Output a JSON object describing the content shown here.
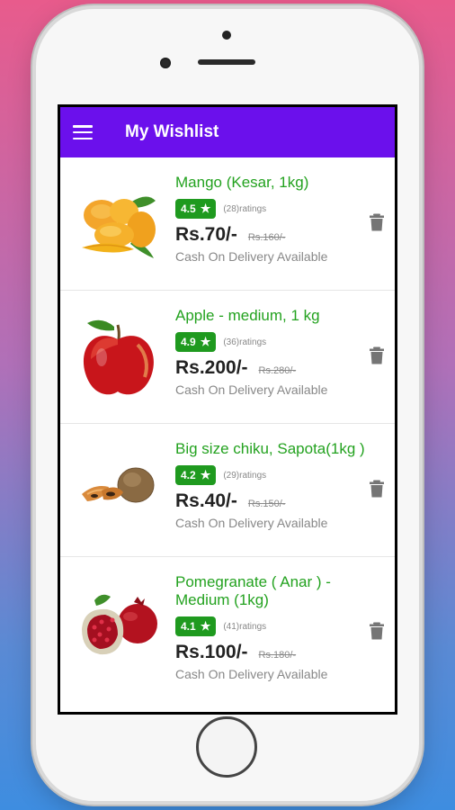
{
  "app_bar": {
    "title": "My Wishlist",
    "menu_icon": "hamburger-menu-icon",
    "color": "#6b10ec"
  },
  "accent_colors": {
    "name": "#23a21f",
    "badge": "#1f9a1f"
  },
  "items": [
    {
      "name": "Mango (Kesar, 1kg)",
      "rating": "4.5",
      "star": "★",
      "ratings": "(28)ratings",
      "price": "Rs.70/-",
      "mrp": "Rs.160/-",
      "cod": "Cash On Delivery Available",
      "image": "mango-image",
      "delete_icon": "trash-icon"
    },
    {
      "name": "Apple - medium, 1 kg",
      "rating": "4.9",
      "star": "★",
      "ratings": "(36)ratings",
      "price": "Rs.200/-",
      "mrp": "Rs.280/-",
      "cod": "Cash On Delivery Available",
      "image": "apple-image",
      "delete_icon": "trash-icon"
    },
    {
      "name": "Big size chiku, Sapota(1kg )",
      "rating": "4.2",
      "star": "★",
      "ratings": "(29)ratings",
      "price": "Rs.40/-",
      "mrp": "Rs.150/-",
      "cod": "Cash On Delivery Available",
      "image": "chiku-image",
      "delete_icon": "trash-icon"
    },
    {
      "name": "Pomegranate ( Anar ) - Medium (1kg)",
      "rating": "4.1",
      "star": "★",
      "ratings": "(41)ratings",
      "price": "Rs.100/-",
      "mrp": "Rs.180/-",
      "cod": "Cash On Delivery Available",
      "image": "pomegranate-image",
      "delete_icon": "trash-icon"
    }
  ]
}
